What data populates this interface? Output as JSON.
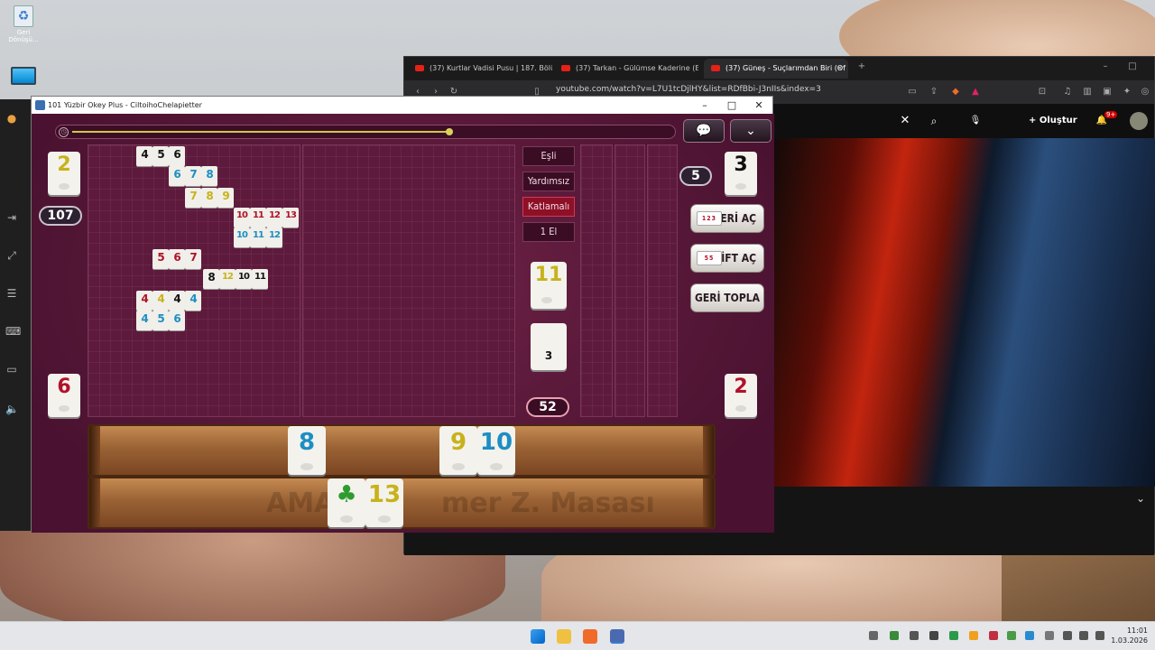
{
  "desktop": {
    "recycle_label": "Geri Dönüşü..."
  },
  "browser": {
    "tabs": [
      "(37) Kurtlar Vadisi Pusu | 187. Bölüm",
      "(37) Tarkan - Gülümse Kaderine (Ene",
      "(37) Güneş - Suçlarımdan Biri (Of"
    ],
    "url": "youtube.com/watch?v=L7U1tcDjlHY&list=RDfBbi-J3nIIs&index=3",
    "create_label": "Oluştur",
    "notif_count": "9+"
  },
  "game": {
    "window_title": "101 Yüzbir Okey Plus - CiltoihoChelapietter",
    "tags": [
      "Eşli",
      "Yardımsız",
      "Katlamalı",
      "1 El"
    ],
    "indicator_tile": "11",
    "deck_tile": "3",
    "deck_count": "52",
    "left_player_score": "2",
    "left_player_points": "107",
    "right_player_score": "3",
    "right_player_badge": "5",
    "bottom_left_score": "6",
    "bottom_right_score": "2",
    "buttons": {
      "seri_ac": "SERİ AÇ",
      "cift_ac": "ÇİFT AÇ",
      "geri_topla": "GERİ TOPLA"
    },
    "rack_watermark_left": "AMATÖ",
    "rack_watermark_right": "mer Z. Masası",
    "rack_top": [
      {
        "n": "8",
        "color": "#1d8ec4"
      },
      {
        "n": "9",
        "color": "#c7b21c"
      },
      {
        "n": "10",
        "color": "#1d8ec4"
      }
    ],
    "rack_bottom": [
      {
        "n": "♣",
        "color": "#2f9b2f"
      },
      {
        "n": "13",
        "color": "#c7b21c"
      }
    ],
    "melds": [
      {
        "tiles": [
          {
            "n": "4",
            "c": "blk"
          },
          {
            "n": "5",
            "c": "blk"
          },
          {
            "n": "6",
            "c": "blk"
          }
        ]
      },
      {
        "tiles": [
          {
            "n": "6",
            "c": "blu"
          },
          {
            "n": "7",
            "c": "blu"
          },
          {
            "n": "8",
            "c": "blu"
          }
        ]
      },
      {
        "tiles": [
          {
            "n": "7",
            "c": "yel"
          },
          {
            "n": "8",
            "c": "yel"
          },
          {
            "n": "9",
            "c": "yel"
          }
        ]
      },
      {
        "tiles": [
          {
            "n": "10",
            "c": "red"
          },
          {
            "n": "11",
            "c": "red"
          },
          {
            "n": "12",
            "c": "red"
          },
          {
            "n": "13",
            "c": "red"
          }
        ]
      },
      {
        "tiles": [
          {
            "n": "10",
            "c": "blu"
          },
          {
            "n": "11",
            "c": "blu"
          },
          {
            "n": "12",
            "c": "blu"
          }
        ]
      },
      {
        "tiles": [
          {
            "n": "5",
            "c": "red"
          },
          {
            "n": "6",
            "c": "red"
          },
          {
            "n": "7",
            "c": "red"
          }
        ]
      },
      {
        "tiles": [
          {
            "n": "8",
            "c": "blk"
          },
          {
            "n": "12",
            "c": "yel"
          },
          {
            "n": "10",
            "c": "blk"
          },
          {
            "n": "11",
            "c": "blk"
          }
        ]
      },
      {
        "tiles": [
          {
            "n": "4",
            "c": "red"
          },
          {
            "n": "4",
            "c": "yel"
          },
          {
            "n": "4",
            "c": "blk"
          },
          {
            "n": "4",
            "c": "blu"
          }
        ]
      },
      {
        "tiles": [
          {
            "n": "4",
            "c": "blu"
          },
          {
            "n": "5",
            "c": "blu"
          },
          {
            "n": "6",
            "c": "blu"
          }
        ]
      }
    ]
  },
  "taskbar": {
    "time": "11:01",
    "date": "1.03.2026"
  }
}
